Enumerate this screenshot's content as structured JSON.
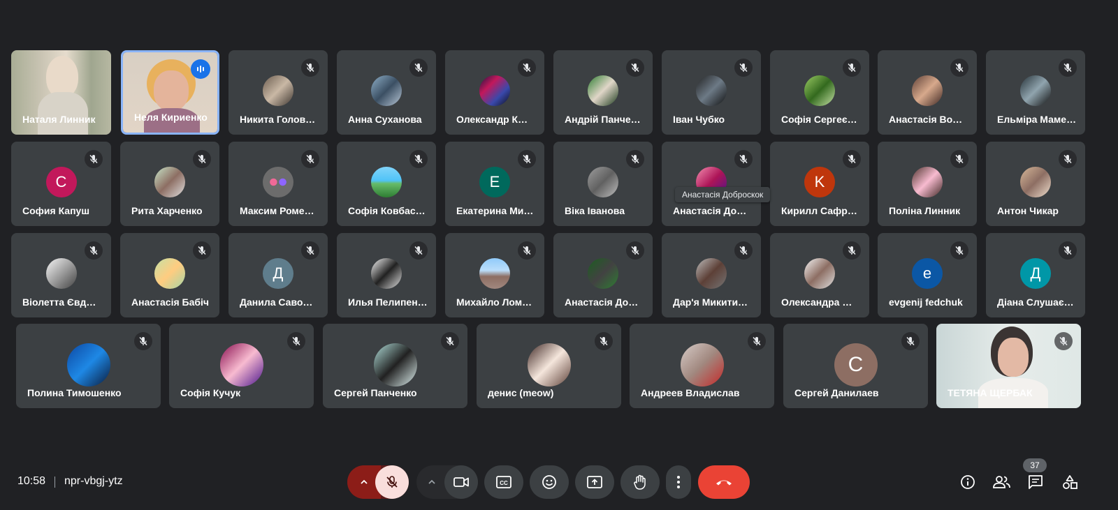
{
  "colors": {
    "background": "#202124",
    "tile": "#3c4043",
    "speaking_border": "#8ab4f8",
    "end_call": "#ea4335",
    "mic_off_bg": "#f9dedc"
  },
  "grid": {
    "row1": [
      {
        "name": "Наталя Линник",
        "kind": "video",
        "muted": false
      },
      {
        "name": "Неля Кириенко",
        "kind": "video",
        "speaking": true
      },
      {
        "name": "Никита Голов…",
        "muted": true,
        "avatar": "photo"
      },
      {
        "name": "Анна Суханова",
        "muted": true,
        "avatar": "photo"
      },
      {
        "name": "Олександр К…",
        "muted": true,
        "avatar": "photo"
      },
      {
        "name": "Андрій Панче…",
        "muted": true,
        "avatar": "photo"
      },
      {
        "name": "Іван Чубко",
        "muted": true,
        "avatar": "photo"
      },
      {
        "name": "Софія Сергеє…",
        "muted": true,
        "avatar": "photo"
      },
      {
        "name": "Анастасія Во…",
        "muted": true,
        "avatar": "photo"
      },
      {
        "name": "Ельміра Маме…",
        "muted": true,
        "avatar": "photo"
      }
    ],
    "row2": [
      {
        "name": "София Капуш",
        "muted": true,
        "initial": "C",
        "color": "#c2185b"
      },
      {
        "name": "Рита Харченко",
        "muted": true,
        "avatar": "photo"
      },
      {
        "name": "Максим Роме…",
        "muted": true,
        "avatar": "photo"
      },
      {
        "name": "Софія Ковбас…",
        "muted": true,
        "avatar": "photo"
      },
      {
        "name": "Екатерина Ми…",
        "muted": true,
        "initial": "E",
        "color": "#00695c"
      },
      {
        "name": "Віка Іванова",
        "muted": true,
        "avatar": "photo"
      },
      {
        "name": "Анастасія До…",
        "muted": true,
        "avatar": "photo"
      },
      {
        "name": "Кирилл Сафр…",
        "muted": true,
        "initial": "K",
        "color": "#bf360c"
      },
      {
        "name": "Поліна Линник",
        "muted": true,
        "avatar": "photo"
      },
      {
        "name": "Антон Чикар",
        "muted": true,
        "avatar": "photo"
      }
    ],
    "row3": [
      {
        "name": "Віолетта Євд…",
        "muted": true,
        "avatar": "photo"
      },
      {
        "name": "Анастасія Бабіч",
        "muted": true,
        "avatar": "photo"
      },
      {
        "name": "Данила Саво…",
        "muted": true,
        "initial": "Д",
        "color": "#5f7d8c"
      },
      {
        "name": "Илья Пелипен…",
        "muted": true,
        "avatar": "photo"
      },
      {
        "name": "Михайло Лом…",
        "muted": true,
        "avatar": "photo"
      },
      {
        "name": "Анастасія До…",
        "muted": true,
        "avatar": "photo"
      },
      {
        "name": "Дар'я Микити…",
        "muted": true,
        "avatar": "photo"
      },
      {
        "name": "Олександра …",
        "muted": true,
        "avatar": "photo"
      },
      {
        "name": "evgenij fedchuk",
        "muted": true,
        "initial": "e",
        "color": "#0b57a5"
      },
      {
        "name": "Діана Слушає…",
        "muted": true,
        "initial": "Д",
        "color": "#0097a7"
      }
    ],
    "row4": [
      {
        "name": "Полина Тимошенко",
        "muted": true,
        "avatar": "photo"
      },
      {
        "name": "Софія Кучук",
        "muted": true,
        "avatar": "photo"
      },
      {
        "name": "Сергей Панченко",
        "muted": true,
        "avatar": "photo"
      },
      {
        "name": "денис (meow)",
        "muted": true,
        "avatar": "photo"
      },
      {
        "name": "Андреев Владислав",
        "muted": true,
        "avatar": "photo"
      },
      {
        "name": "Сергей Данилаев",
        "muted": true,
        "initial": "C",
        "color": "#8d6e63"
      },
      {
        "name": "ТЕТЯНА ЩЕРБАК",
        "kind": "video",
        "muted": true
      }
    ]
  },
  "tooltip": "Анастасія Доброскок",
  "meeting": {
    "time": "10:58",
    "code": "npr-vbgj-ytz",
    "participants_count": "37"
  },
  "controls": {
    "icons": [
      "chevron-up-icon",
      "mic-off-icon",
      "chevron-up-icon",
      "camera-icon",
      "captions-icon",
      "emoji-icon",
      "present-icon",
      "raise-hand-icon",
      "more-icon",
      "end-call-icon"
    ],
    "right_icons": [
      "info-icon",
      "people-icon",
      "chat-icon",
      "activities-icon"
    ]
  }
}
